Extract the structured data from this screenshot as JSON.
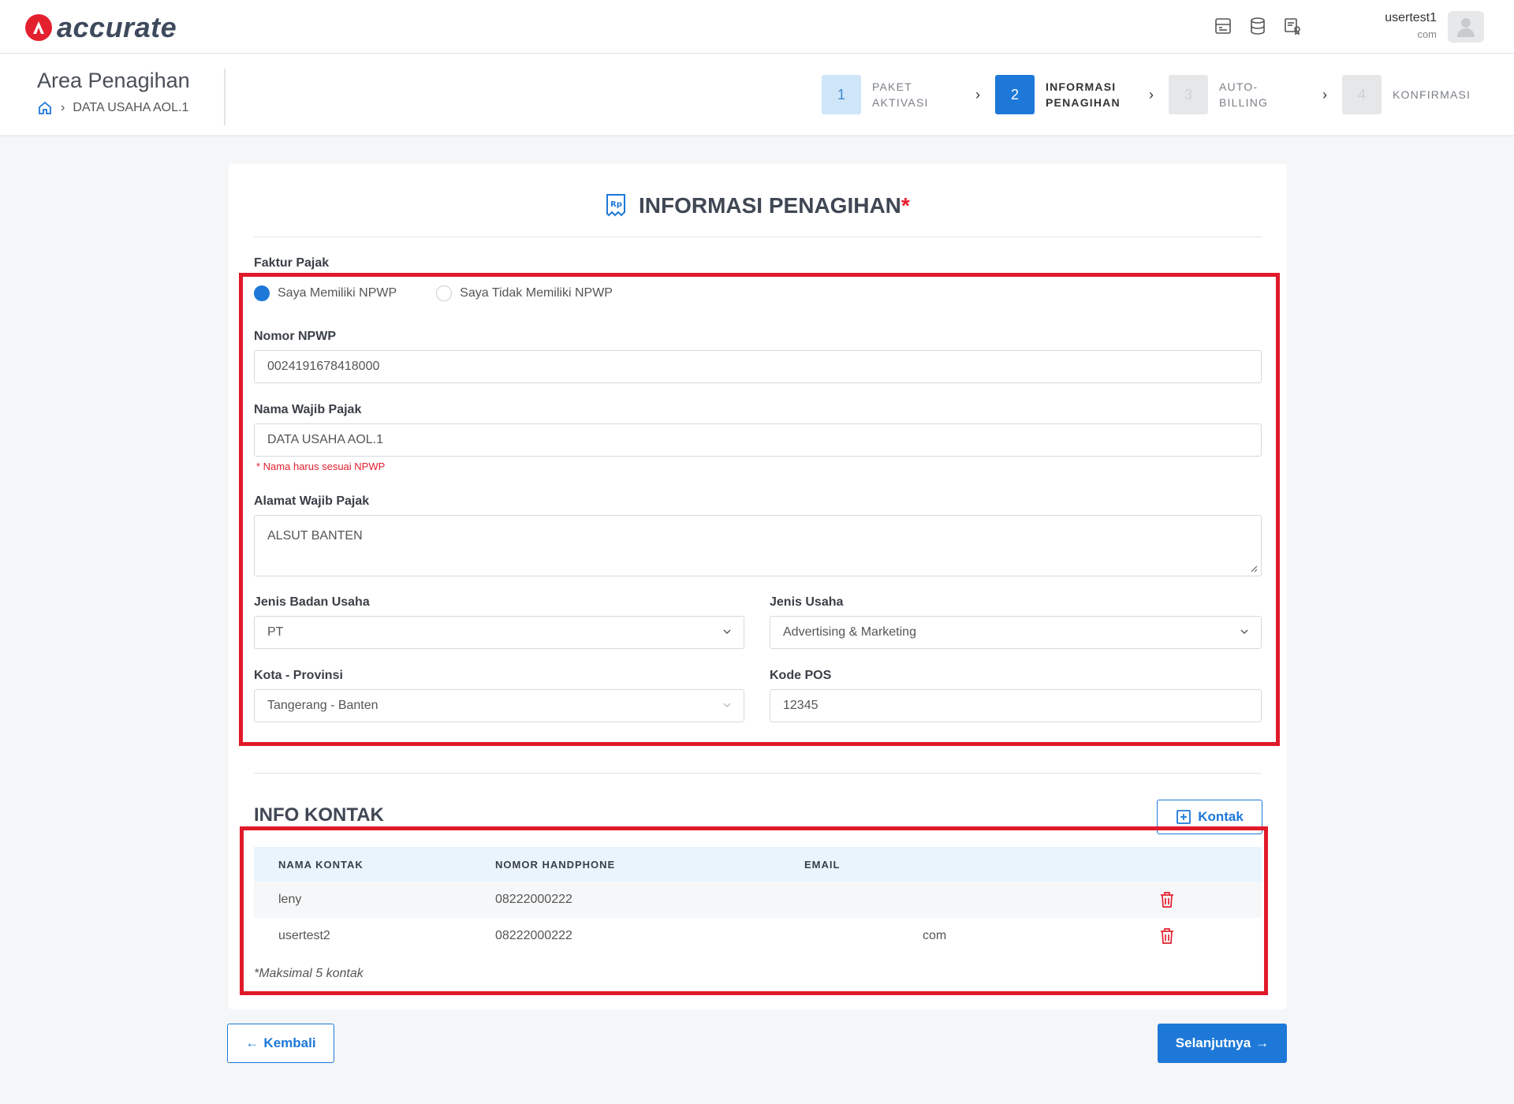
{
  "app": {
    "logo_text": "accurate"
  },
  "user": {
    "name": "usertest1",
    "email": "com"
  },
  "header": {
    "title": "Area Penagihan",
    "breadcrumb": "DATA USAHA AOL.1"
  },
  "steps": [
    {
      "num": "1",
      "line1": "PAKET",
      "line2": "AKTIVASI",
      "state": "done"
    },
    {
      "num": "2",
      "line1": "INFORMASI",
      "line2": "PENAGIHAN",
      "state": "active"
    },
    {
      "num": "3",
      "line1": "AUTO-",
      "line2": "BILLING",
      "state": "todo"
    },
    {
      "num": "4",
      "line1": "KONFIRMASI",
      "line2": "",
      "state": "todo"
    }
  ],
  "form": {
    "title": "INFORMASI PENAGIHAN",
    "required_mark": "*",
    "faktur_label": "Faktur Pajak",
    "radio_yes": "Saya Memiliki NPWP",
    "radio_no": "Saya Tidak Memiliki NPWP",
    "npwp_label": "Nomor NPWP",
    "npwp_value": "0024191678418000",
    "nama_label": "Nama Wajib Pajak",
    "nama_value": "DATA USAHA AOL.1",
    "nama_hint": "* Nama harus sesuai NPWP",
    "alamat_label": "Alamat Wajib Pajak",
    "alamat_value": "ALSUT BANTEN",
    "badan_label": "Jenis Badan Usaha",
    "badan_value": "PT",
    "usaha_label": "Jenis Usaha",
    "usaha_value": "Advertising & Marketing",
    "kota_label": "Kota - Provinsi",
    "kota_value": "Tangerang - Banten",
    "pos_label": "Kode POS",
    "pos_value": "12345"
  },
  "kontak": {
    "title": "INFO KONTAK",
    "add_button": "Kontak",
    "columns": [
      "NAMA KONTAK",
      "NOMOR HANDPHONE",
      "EMAIL"
    ],
    "rows": [
      {
        "nama": "leny",
        "hp": "08222000222",
        "email": ""
      },
      {
        "nama": "usertest2",
        "hp": "08222000222",
        "email": "com"
      }
    ],
    "note": "*Maksimal 5 kontak"
  },
  "buttons": {
    "back": "Kembali",
    "next": "Selanjutnya"
  },
  "colors": {
    "primary": "#1d78d8",
    "brand_red": "#e4202e",
    "highlight": "#e01a2a"
  }
}
